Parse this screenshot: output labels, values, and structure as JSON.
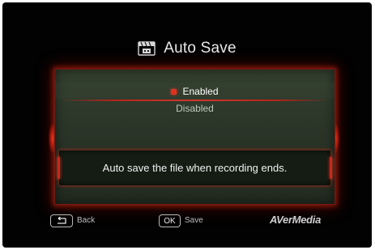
{
  "screen": {
    "title": "Auto Save",
    "title_icon": "film-clapper-icon"
  },
  "options": {
    "selected": "Enabled",
    "items": [
      {
        "label": "Enabled",
        "selected": true
      },
      {
        "label": "Disabled",
        "selected": false
      }
    ]
  },
  "description": "Auto save the file when recording ends.",
  "footer": {
    "back_label": "Back",
    "ok_key": "OK",
    "save_label": "Save",
    "brand": "AVerMedia"
  },
  "colors": {
    "accent_red": "#d3362a",
    "panel_bg": "#2a3528",
    "screen_bg": "#020202"
  }
}
